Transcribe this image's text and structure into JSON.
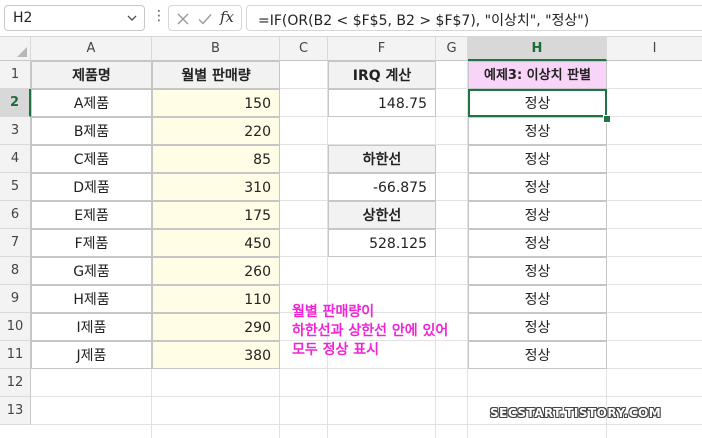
{
  "formula_bar": {
    "name_box": "H2",
    "fx_label": "fx",
    "formula": "=IF(OR(B2 < $F$5, B2 > $F$7), \"이상치\", \"정상\")"
  },
  "columns": [
    "A",
    "B",
    "C",
    "F",
    "G",
    "H",
    "I"
  ],
  "rows": [
    "1",
    "2",
    "3",
    "4",
    "5",
    "6",
    "7",
    "8",
    "9",
    "10",
    "11",
    "12",
    "13"
  ],
  "table": {
    "headers": [
      "제품명",
      "월별 판매량"
    ],
    "rows": [
      {
        "product": "A제품",
        "sales": "150"
      },
      {
        "product": "B제품",
        "sales": "220"
      },
      {
        "product": "C제품",
        "sales": "85"
      },
      {
        "product": "D제품",
        "sales": "310"
      },
      {
        "product": "E제품",
        "sales": "175"
      },
      {
        "product": "F제품",
        "sales": "450"
      },
      {
        "product": "G제품",
        "sales": "260"
      },
      {
        "product": "H제품",
        "sales": "110"
      },
      {
        "product": "I제품",
        "sales": "290"
      },
      {
        "product": "J제품",
        "sales": "380"
      }
    ]
  },
  "iqr": {
    "header": "IRQ 계산",
    "value": "148.75",
    "lower_label": "하한선",
    "lower_value": "-66.875",
    "upper_label": "상한선",
    "upper_value": "528.125"
  },
  "result": {
    "header": "예제3: 이상치 판별",
    "values": [
      "정상",
      "정상",
      "정상",
      "정상",
      "정상",
      "정상",
      "정상",
      "정상",
      "정상",
      "정상"
    ]
  },
  "annotation": {
    "lines": [
      "월별 판매량이",
      "하한선과 상한선 안에 있어",
      "모두 정상 표시"
    ]
  },
  "watermark": "SECSTART.TISTORY.COM",
  "colors": {
    "accent_green": "#217346",
    "header_pink": "#f8d4f8",
    "value_yellow": "#fffde6",
    "annotation_magenta": "#f025d6"
  }
}
